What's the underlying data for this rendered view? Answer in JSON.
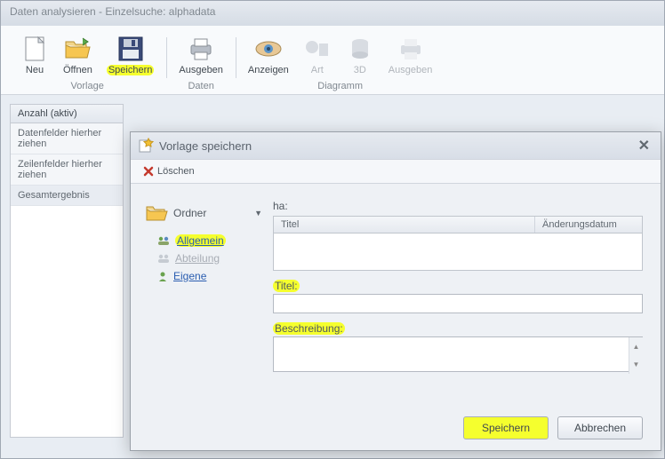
{
  "window": {
    "title": "Daten analysieren - Einzelsuche: alphadata"
  },
  "ribbon": {
    "groups": {
      "vorlage": {
        "label": "Vorlage",
        "neu": "Neu",
        "oeffnen": "Öffnen",
        "speichern": "Speichern"
      },
      "daten": {
        "label": "Daten",
        "ausgeben": "Ausgeben"
      },
      "diagramm": {
        "label": "Diagramm",
        "anzeigen": "Anzeigen",
        "art": "Art",
        "dd": "3D",
        "ausgeben": "Ausgeben"
      }
    }
  },
  "sidebar": {
    "tab": "Anzahl (aktiv)",
    "rows": {
      "daten": "Datenfelder hierher ziehen",
      "zeilen": "Zeilenfelder hierher ziehen",
      "gesamt": "Gesamtergebnis"
    }
  },
  "dialog": {
    "title": "Vorlage speichern",
    "loeschen": "Löschen",
    "ordner": "Ordner",
    "folders": {
      "allgemein": "Allgemein",
      "abteilung": "Abteilung",
      "eigene": "Eigene"
    },
    "ha": "ha:",
    "grid": {
      "titel": "Titel",
      "datum": "Änderungsdatum"
    },
    "titel_label": "Titel:",
    "titel_value": "",
    "beschr_label": "Beschreibung:",
    "beschr_value": "",
    "save": "Speichern",
    "cancel": "Abbrechen"
  }
}
